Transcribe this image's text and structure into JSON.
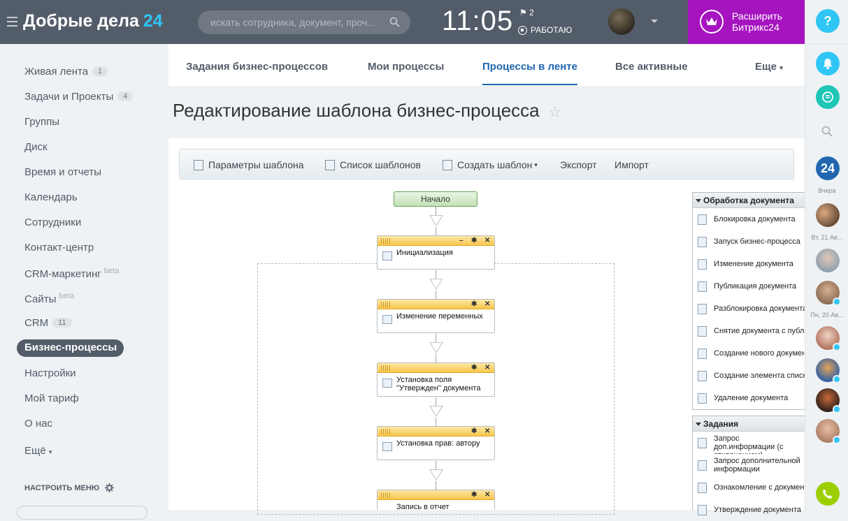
{
  "header": {
    "logo_name": "Добрые дела",
    "logo_num": "24",
    "search_placeholder": "искать сотрудника, документ, проч...",
    "clock": "11:05",
    "flag_count": "2",
    "work_status": "РАБОТАЮ",
    "upgrade_label_1": "Расширить",
    "upgrade_label_2": "Битрикс24"
  },
  "sidebar": {
    "items": [
      {
        "label": "Живая лента",
        "count": "1"
      },
      {
        "label": "Задачи и Проекты",
        "count": "4"
      },
      {
        "label": "Группы"
      },
      {
        "label": "Диск"
      },
      {
        "label": "Время и отчеты"
      },
      {
        "label": "Календарь"
      },
      {
        "label": "Сотрудники"
      },
      {
        "label": "Контакт-центр"
      },
      {
        "label": "CRM-маркетинг",
        "sup": "beta"
      },
      {
        "label": "Сайты",
        "sup": "beta"
      },
      {
        "label": "CRM",
        "count": "11"
      },
      {
        "label": "Бизнес-процессы"
      },
      {
        "label": "Настройки"
      },
      {
        "label": "Мой тариф"
      },
      {
        "label": "О нас"
      },
      {
        "label": "Ещё"
      }
    ],
    "configure": "НАСТРОИТЬ МЕНЮ"
  },
  "tabs": [
    "Задания бизнес-процессов",
    "Мои процессы",
    "Процессы в ленте",
    "Все активные",
    "Еще"
  ],
  "page_title": "Редактирование шаблона бизнес-процесса",
  "toolbar": {
    "params": "Параметры шаблона",
    "list": "Список шаблонов",
    "create": "Создать шаблон",
    "export": "Экспорт",
    "import": "Импорт"
  },
  "designer": {
    "start": "Начало",
    "activities": [
      "Инициализация",
      "Изменение переменных",
      "Установка поля \"Утвержден\" документа",
      "Установка прав: автору",
      "Запись в отчет"
    ]
  },
  "palette": {
    "group1": "Обработка документа",
    "group1_items": [
      "Блокировка документа",
      "Запуск бизнес-процесса",
      "Изменение документа",
      "Публикация документа",
      "Разблокировка документа",
      "Снятие документа с публикации",
      "Создание нового документа",
      "Создание элемента списка",
      "Удаление документа"
    ],
    "group2": "Задания",
    "group2_items": [
      "Запрос доп.информации (с отклонением)",
      "Запрос дополнительной информации",
      "Ознакомление с документом",
      "Утверждение документа"
    ]
  },
  "rightbar": {
    "help": "?",
    "b24": "24",
    "label_yesterday": "Вчера",
    "label_date1": "Вт, 21 Ав...",
    "label_date2": "Пн, 20 Ав..."
  }
}
